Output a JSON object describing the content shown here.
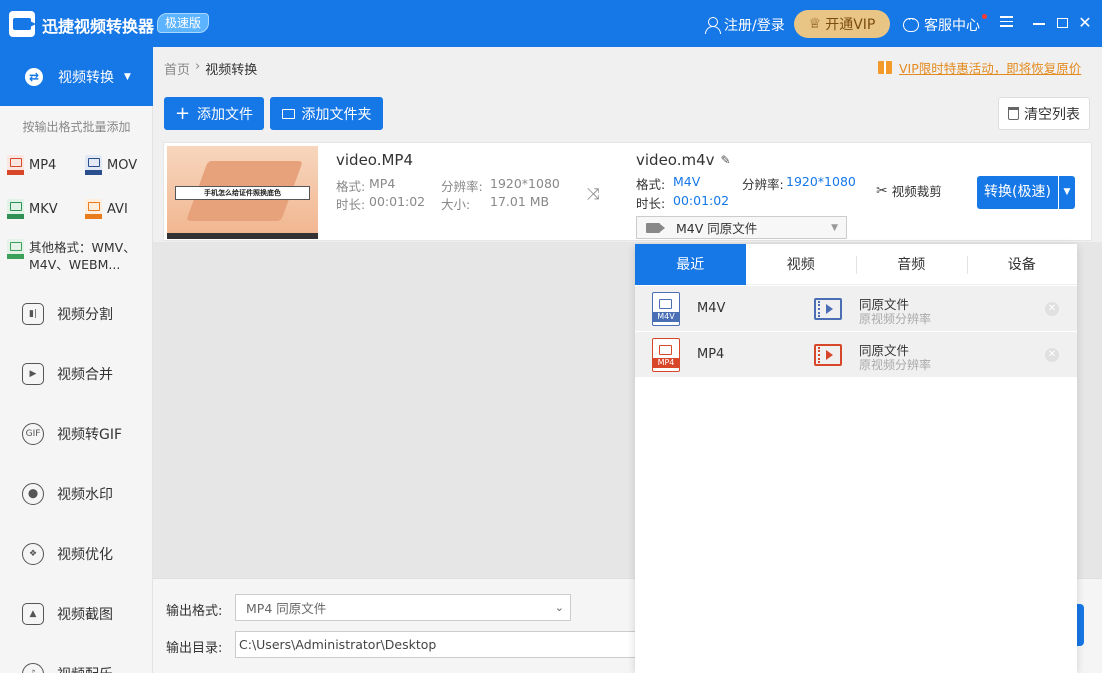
{
  "titlebar": {
    "app_title": "迅捷视频转换器",
    "badge": "极速版",
    "login": "注册/登录",
    "vip": "开通VIP",
    "service": "客服中心"
  },
  "sidebar": {
    "convert_label": "视频转换",
    "hint": "按输出格式批量添加",
    "formats": [
      "MP4",
      "MOV",
      "MKV",
      "AVI"
    ],
    "other_formats": "其他格式：WMV、M4V、WEBM...",
    "tools": [
      "视频分割",
      "视频合并",
      "视频转GIF",
      "视频水印",
      "视频优化",
      "视频截图",
      "视频配乐"
    ]
  },
  "breadcrumb": {
    "home": "首页",
    "sep": "›",
    "current": "视频转换"
  },
  "promo": "VIP限时特惠活动，即将恢复原价",
  "toolbar": {
    "add_file": "添加文件",
    "add_folder": "添加文件夹",
    "clear_list": "清空列表"
  },
  "file": {
    "thumb_caption": "手机怎么给证件照换底色",
    "source": {
      "name": "video.MP4",
      "format_label": "格式:",
      "format": "MP4",
      "resolution_label": "分辨率:",
      "resolution": "1920*1080",
      "duration_label": "时长:",
      "duration": "00:01:02",
      "size_label": "大小:",
      "size": "17.01 MB"
    },
    "target": {
      "name": "video.m4v",
      "format_label": "格式:",
      "format": "M4V",
      "resolution_label": "分辨率:",
      "resolution": "1920*1080",
      "duration_label": "时长:",
      "duration": "00:01:02"
    },
    "format_select": "M4V  同原文件",
    "crop": "视频裁剪",
    "convert": "转换(极速)"
  },
  "dropdown": {
    "tabs": [
      "最近",
      "视频",
      "音频",
      "设备"
    ],
    "active_tab": "最近",
    "rows": [
      {
        "fmt": "M4V",
        "tag": "M4V",
        "quality": "同原文件",
        "sub": "原视频分辨率",
        "color": "#4a6fb5"
      },
      {
        "fmt": "MP4",
        "tag": "MP4",
        "quality": "同原文件",
        "sub": "原视频分辨率",
        "color": "#d9472b"
      }
    ]
  },
  "output": {
    "format_label": "输出格式:",
    "format_value": "MP4  同原文件",
    "dir_label": "输出目录:",
    "dir_value": "C:\\Users\\Administrator\\Desktop"
  },
  "colors": {
    "primary": "#1677e6",
    "vip_gold": "#e9c585",
    "promo_orange": "#e48a1d"
  }
}
